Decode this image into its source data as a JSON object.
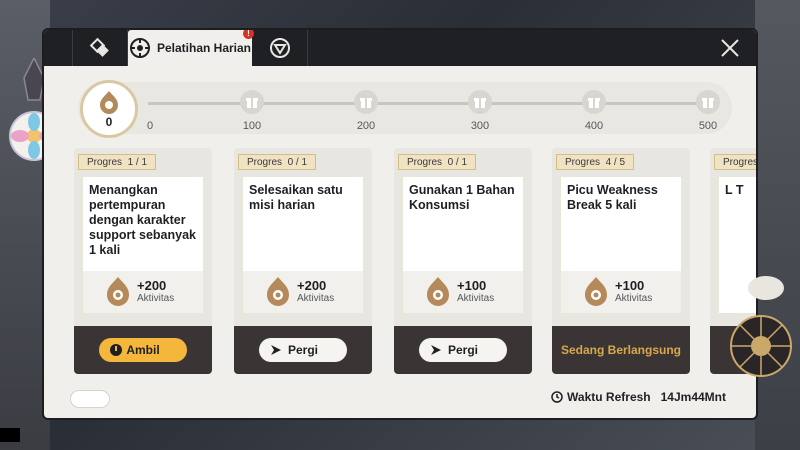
{
  "tabs": [
    {
      "name": "daily-training-tab",
      "label": "Pelatihan Harian",
      "badge": "!"
    }
  ],
  "progress": {
    "current": "0",
    "milestones": [
      "0",
      "100",
      "200",
      "300",
      "400",
      "500"
    ]
  },
  "cards": [
    {
      "progress": "Progres  1 / 1",
      "title": "Menangkan pertempuran dengan karakter support sebanyak 1 kali",
      "reward": "+200",
      "reward_unit": "Aktivitas",
      "action": "Ambil"
    },
    {
      "progress": "Progres  0 / 1",
      "title": "Selesaikan satu misi harian",
      "reward": "+200",
      "reward_unit": "Aktivitas",
      "action": "Pergi"
    },
    {
      "progress": "Progres  0 / 1",
      "title": "Gunakan 1 Bahan Konsumsi",
      "reward": "+100",
      "reward_unit": "Aktivitas",
      "action": "Pergi"
    },
    {
      "progress": "Progres  4 / 5",
      "title": "Picu Weakness Break 5 kali",
      "reward": "+100",
      "reward_unit": "Aktivitas",
      "action": "Sedang Berlangsung"
    },
    {
      "progress": "Progres",
      "title": "L T",
      "reward": "",
      "reward_unit": "",
      "action": "S"
    }
  ],
  "refresh": {
    "label": "Waktu Refresh",
    "time": "14Jm44Mnt"
  },
  "colors": {
    "accent": "#f4b73c",
    "dark": "#1f2023",
    "ongoing": "#d9a84d"
  }
}
